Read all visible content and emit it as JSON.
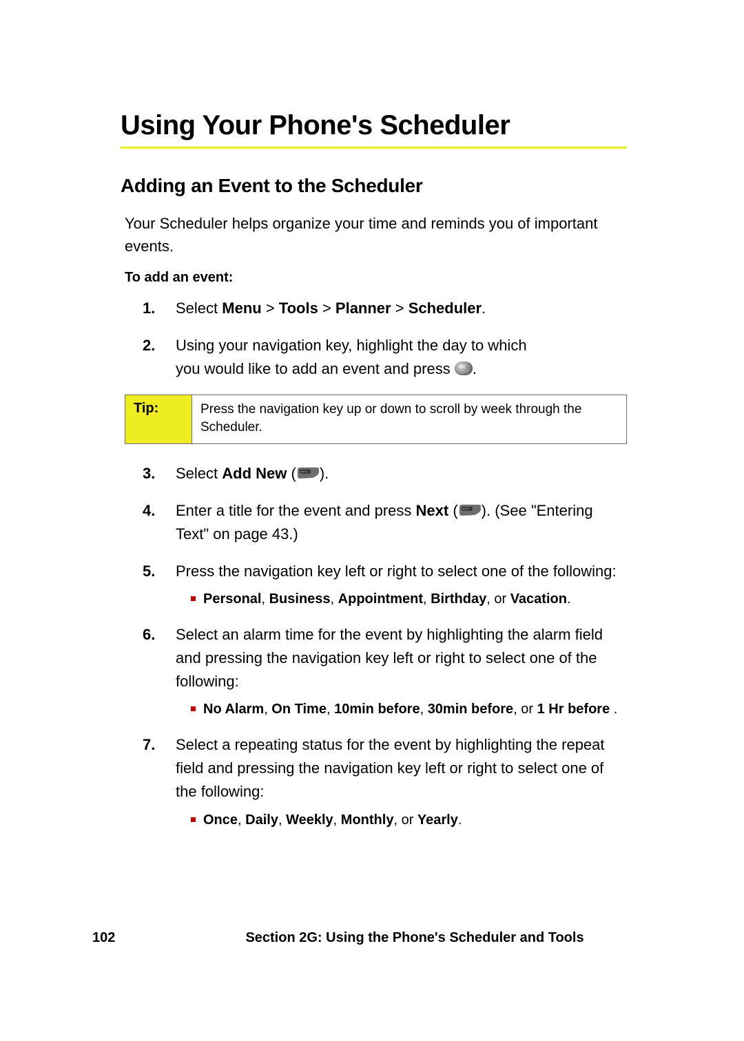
{
  "title": "Using Your Phone's Scheduler",
  "subtitle": "Adding an Event to the Scheduler",
  "intro": "Your Scheduler helps organize your time and reminds you of important events.",
  "lead": "To add an event:",
  "steps": {
    "s1": {
      "prefix": "Select ",
      "menu": "Menu",
      "gt1": " > ",
      "tools": "Tools",
      "gt2": " > ",
      "planner": "Planner",
      "gt3": " > ",
      "scheduler": "Scheduler",
      "suffix": "."
    },
    "s2": {
      "line1": "Using your navigation key, highlight the day to which",
      "line2a": "you would like to add an event and press ",
      "line2b": "."
    },
    "s3": {
      "prefix": "Select ",
      "addnew": "Add New",
      "open": " (",
      "close": ")."
    },
    "s4": {
      "prefix": "Enter a title for the event and press ",
      "next": "Next",
      "open": " (",
      "close": "). (See ",
      "ref": "\"Entering Text\" on page 43.)"
    },
    "s5": {
      "text": "Press the navigation key left or right to select one of the following:",
      "opts": {
        "a": "Personal",
        "b": "Business",
        "c": "Appointment",
        "d": "Birthday",
        "e": "Vacation",
        "or": ", or "
      }
    },
    "s6": {
      "text": "Select an alarm time for the event by highlighting the alarm field and pressing the navigation key left or right to select one of the following:",
      "opts": {
        "a": "No Alarm",
        "b": "On Time",
        "c": "10min before",
        "d": "30min before",
        "e": "1 Hr before",
        "or": ", or "
      }
    },
    "s7": {
      "text": "Select a repeating status for the event by highlighting the repeat field and pressing the navigation key left or right to select one of the following:",
      "opts": {
        "a": "Once",
        "b": "Daily",
        "c": "Weekly",
        "d": "Monthly",
        "e": "Yearly",
        "or": ", or "
      }
    }
  },
  "tip": {
    "label": "Tip:",
    "body": "Press the navigation key up or down to scroll by week through the Scheduler."
  },
  "footer": {
    "page": "102",
    "section": "Section 2G: Using the Phone's Scheduler and Tools"
  }
}
